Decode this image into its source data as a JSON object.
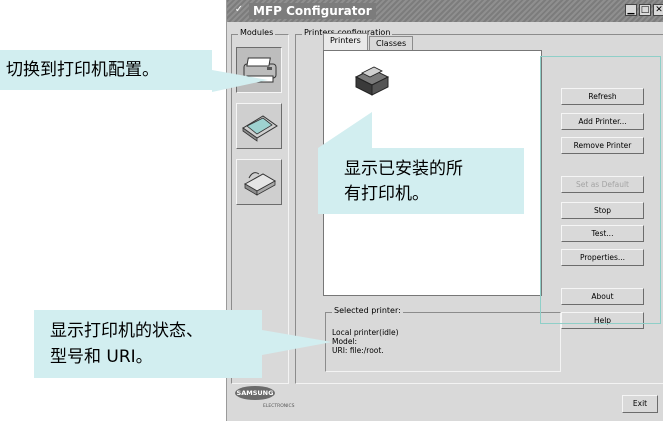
{
  "window": {
    "title": "MFP Configurator",
    "menu_glyph": "✓",
    "title_buttons": [
      "▁",
      "□",
      "✕"
    ]
  },
  "modules": {
    "label": "Modules",
    "items": [
      {
        "name": "printer",
        "icon": "printer-icon",
        "active": true
      },
      {
        "name": "scanner",
        "icon": "scanner-icon",
        "active": false
      },
      {
        "name": "port",
        "icon": "port-icon",
        "active": false
      }
    ],
    "logo_text": "SAMSUNG",
    "logo_sub": "ELECTRONICS"
  },
  "printers_config": {
    "label": "Printers configuration",
    "tabs": [
      "Printers",
      "Classes"
    ],
    "active_tab": "Printers"
  },
  "side_buttons": [
    {
      "label": "Refresh",
      "enabled": true
    },
    {
      "label": "Add Printer...",
      "enabled": true
    },
    {
      "label": "Remove Printer",
      "enabled": true
    },
    {
      "label": "Set as Default",
      "enabled": false
    },
    {
      "label": "Stop",
      "enabled": true
    },
    {
      "label": "Test...",
      "enabled": true
    },
    {
      "label": "Properties...",
      "enabled": true
    },
    {
      "label": "About",
      "enabled": true
    },
    {
      "label": "Help",
      "enabled": true
    }
  ],
  "selected_printer": {
    "label": "Selected printer:",
    "line1": "Local printer(idle)",
    "line2": "Model:",
    "line3": "URI: file:/root."
  },
  "exit_label": "Exit",
  "callouts": {
    "switch": "切换到打印机配置。",
    "installed_line1": "显示已安装的所",
    "installed_line2": "有打印机。",
    "status_line1": "显示打印机的状态、",
    "status_line2": "型号和 URI。"
  },
  "colors": {
    "callout_bg": "#d2eef0",
    "highlight_border": "#8fcfc8",
    "window_bg": "#d9d9d9",
    "titlebar": "#7c7c7c"
  }
}
